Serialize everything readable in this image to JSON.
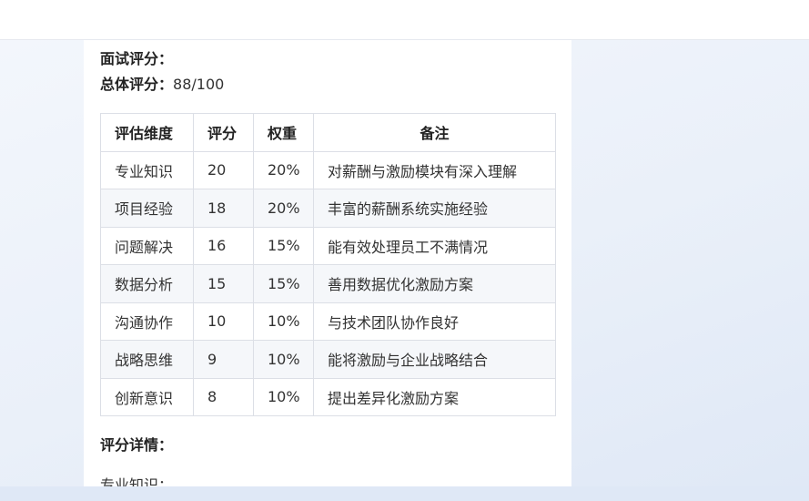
{
  "interview": {
    "heading": "面试评分：",
    "overall_label": "总体评分",
    "overall_sep": "：",
    "overall_value": "88/100"
  },
  "table": {
    "headers": [
      "评估维度",
      "评分",
      "权重",
      "备注"
    ],
    "rows": [
      {
        "dimension": "专业知识",
        "score": "20",
        "weight": "20%",
        "note": "对薪酬与激励模块有深入理解"
      },
      {
        "dimension": "项目经验",
        "score": "18",
        "weight": "20%",
        "note": "丰富的薪酬系统实施经验"
      },
      {
        "dimension": "问题解决",
        "score": "16",
        "weight": "15%",
        "note": "能有效处理员工不满情况"
      },
      {
        "dimension": "数据分析",
        "score": "15",
        "weight": "15%",
        "note": "善用数据优化激励方案"
      },
      {
        "dimension": "沟通协作",
        "score": "10",
        "weight": "10%",
        "note": "与技术团队协作良好"
      },
      {
        "dimension": "战略思维",
        "score": "9",
        "weight": "10%",
        "note": "能将激励与企业战略结合"
      },
      {
        "dimension": "创新意识",
        "score": "8",
        "weight": "10%",
        "note": "提出差异化激励方案"
      }
    ]
  },
  "details": {
    "heading": "评分详情：",
    "first_item": "专业知识："
  }
}
